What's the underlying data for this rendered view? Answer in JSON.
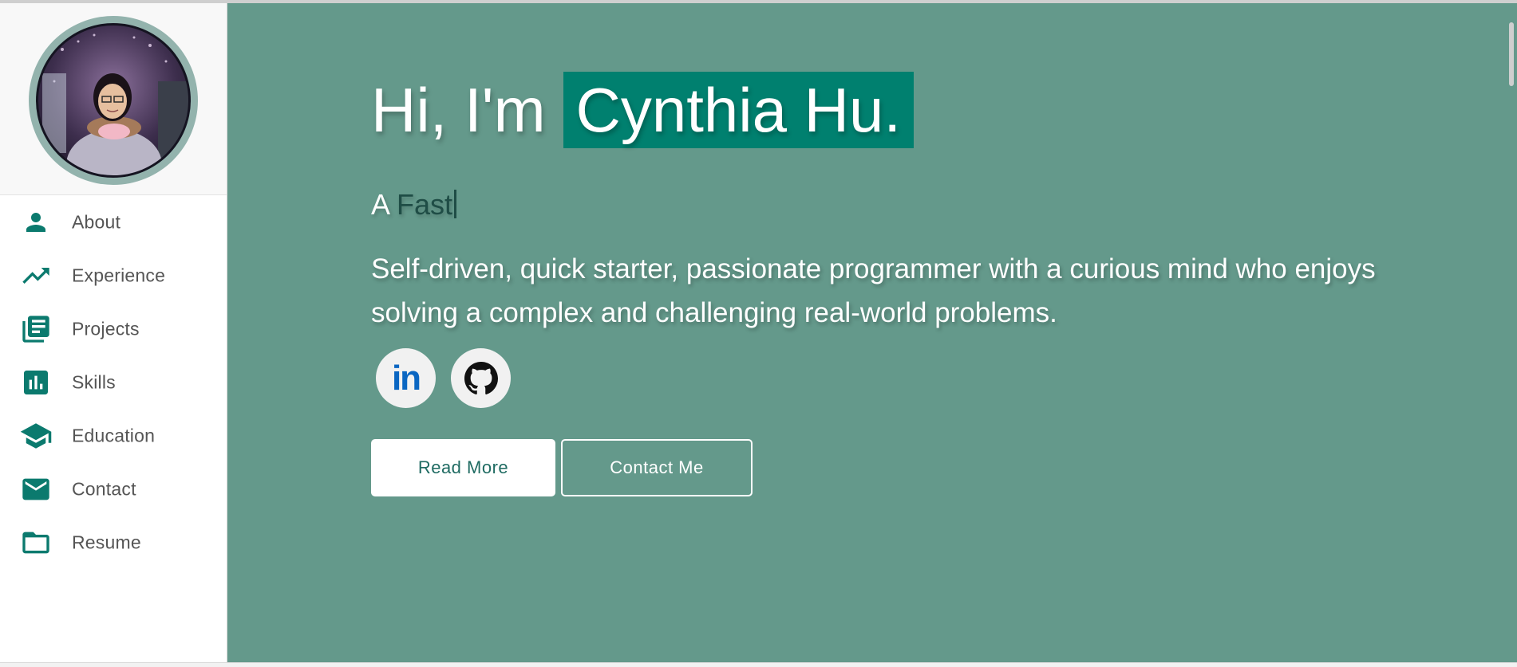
{
  "colors": {
    "accent": "#00806f",
    "hero_background": "#64998b",
    "sidebar_icon": "#0b7a6e"
  },
  "sidebar": {
    "items": [
      {
        "label": "About",
        "icon": "person-icon"
      },
      {
        "label": "Experience",
        "icon": "trending-up-icon"
      },
      {
        "label": "Projects",
        "icon": "library-books-icon"
      },
      {
        "label": "Skills",
        "icon": "bar-chart-icon"
      },
      {
        "label": "Education",
        "icon": "graduation-cap-icon"
      },
      {
        "label": "Contact",
        "icon": "mail-icon"
      },
      {
        "label": "Resume",
        "icon": "folder-icon"
      }
    ]
  },
  "hero": {
    "greeting_prefix": "Hi, I'm",
    "name": "Cynthia Hu.",
    "tagline_prefix": "A",
    "tagline_word": "Fast",
    "bio": "Self-driven, quick starter, passionate programmer with a curious mind who enjoys solving a complex and challenging real-world problems.",
    "linkedin_label": "in",
    "read_more_label": "Read More",
    "contact_label": "Contact Me"
  }
}
